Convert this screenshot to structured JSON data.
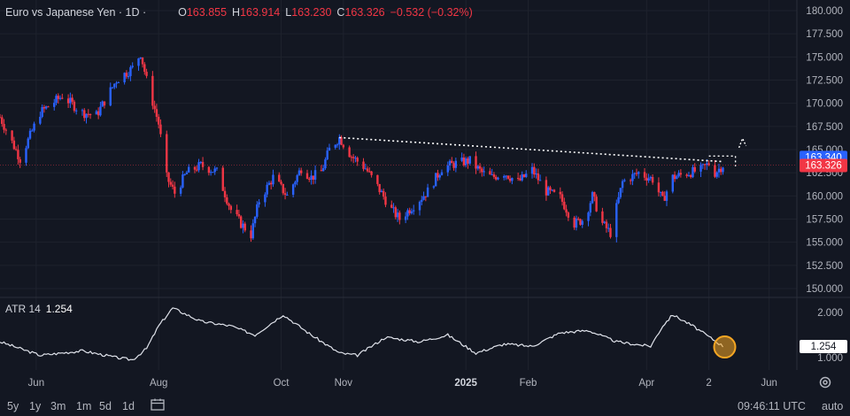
{
  "header": {
    "title": "Euro vs Japanese Yen · 1D ·",
    "o_label": "O",
    "o_value": "163.855",
    "h_label": "H",
    "h_value": "163.914",
    "l_label": "L",
    "l_value": "163.230",
    "c_label": "C",
    "c_value": "163.326",
    "change": "−0.532 (−0.32%)"
  },
  "atr": {
    "label": "ATR 14",
    "value": "1.254",
    "axis_ticks": [
      "2.000",
      "1.000"
    ],
    "badge": "1.254"
  },
  "price_badges": {
    "upper": "163.340",
    "lower": "163.326"
  },
  "timeframes": [
    "5y",
    "1y",
    "3m",
    "1m",
    "5d",
    "1d"
  ],
  "time": "09:46:11 UTC",
  "auto": "auto",
  "colors": {
    "up": "#2962ff",
    "down": "#f23645",
    "bg": "#131722",
    "grid": "#1e222d",
    "atr": "#e0e3eb",
    "highlight": "#f5a623"
  },
  "chart_data": {
    "type": "candlestick",
    "title": "Euro vs Japanese Yen · 1D",
    "y_ticks": [
      180,
      177.5,
      175,
      172.5,
      170,
      167.5,
      165,
      162.5,
      160,
      157.5,
      155,
      152.5,
      150
    ],
    "x_ticks": [
      "Jun",
      "Aug",
      "Oct",
      "Nov",
      "2025",
      "Feb",
      "Apr",
      "2",
      "Jun"
    ],
    "close_path": [
      [
        "2024-05-14",
        168.5
      ],
      [
        "2024-05-24",
        164.0
      ],
      [
        "2024-06-03",
        169.0
      ],
      [
        "2024-06-14",
        170.8
      ],
      [
        "2024-06-24",
        169.0
      ],
      [
        "2024-07-01",
        168.7
      ],
      [
        "2024-07-11",
        172.5
      ],
      [
        "2024-07-19",
        173.8
      ],
      [
        "2024-07-23",
        175.4
      ],
      [
        "2024-07-26",
        172.5
      ],
      [
        "2024-08-01",
        167.8
      ],
      [
        "2024-08-05",
        162.0
      ],
      [
        "2024-08-09",
        160.3
      ],
      [
        "2024-08-15",
        162.5
      ],
      [
        "2024-08-22",
        163.3
      ],
      [
        "2024-08-30",
        162.6
      ],
      [
        "2024-09-06",
        158.5
      ],
      [
        "2024-09-11",
        157.0
      ],
      [
        "2024-09-16",
        155.8
      ],
      [
        "2024-09-20",
        159.5
      ],
      [
        "2024-09-27",
        162.0
      ],
      [
        "2024-10-04",
        160.0
      ],
      [
        "2024-10-11",
        163.0
      ],
      [
        "2024-10-16",
        162.0
      ],
      [
        "2024-10-21",
        162.6
      ],
      [
        "2024-10-25",
        165.0
      ],
      [
        "2024-10-30",
        166.3
      ],
      [
        "2024-11-05",
        164.3
      ],
      [
        "2024-11-12",
        163.0
      ],
      [
        "2024-11-18",
        161.0
      ],
      [
        "2024-11-25",
        158.5
      ],
      [
        "2024-11-29",
        157.5
      ],
      [
        "2024-12-06",
        159.0
      ],
      [
        "2024-12-13",
        160.5
      ],
      [
        "2024-12-20",
        163.0
      ],
      [
        "2024-12-27",
        163.5
      ],
      [
        "2025-01-03",
        163.8
      ],
      [
        "2025-01-09",
        162.5
      ],
      [
        "2025-01-14",
        162.0
      ],
      [
        "2025-01-20",
        162.5
      ],
      [
        "2025-01-27",
        161.5
      ],
      [
        "2025-02-03",
        162.8
      ],
      [
        "2025-02-10",
        160.5
      ],
      [
        "2025-02-17",
        159.8
      ],
      [
        "2025-02-24",
        157.0
      ],
      [
        "2025-03-01",
        157.5
      ],
      [
        "2025-03-05",
        160.0
      ],
      [
        "2025-03-10",
        157.0
      ],
      [
        "2025-03-14",
        156.0
      ],
      [
        "2025-03-20",
        161.5
      ],
      [
        "2025-03-28",
        162.5
      ],
      [
        "2025-04-04",
        161.8
      ],
      [
        "2025-04-09",
        159.5
      ],
      [
        "2025-04-14",
        162.0
      ],
      [
        "2025-04-22",
        162.5
      ],
      [
        "2025-04-28",
        162.8
      ],
      [
        "2025-05-02",
        163.5
      ],
      [
        "2025-05-05",
        162.5
      ],
      [
        "2025-05-09",
        163.326
      ]
    ],
    "trendline": {
      "from": [
        "2024-10-30",
        166.3
      ],
      "to": [
        "2025-05-09",
        163.7
      ],
      "style": "dotted"
    },
    "atr_path": [
      [
        "2024-05-14",
        1.35
      ],
      [
        "2024-06-03",
        1.05
      ],
      [
        "2024-06-24",
        1.15
      ],
      [
        "2024-07-11",
        1.0
      ],
      [
        "2024-07-19",
        0.95
      ],
      [
        "2024-07-26",
        1.2
      ],
      [
        "2024-08-01",
        1.7
      ],
      [
        "2024-08-08",
        2.1
      ],
      [
        "2024-08-22",
        1.8
      ],
      [
        "2024-09-06",
        1.7
      ],
      [
        "2024-09-18",
        1.5
      ],
      [
        "2024-10-02",
        1.95
      ],
      [
        "2024-10-16",
        1.5
      ],
      [
        "2024-10-30",
        1.1
      ],
      [
        "2024-11-08",
        1.05
      ],
      [
        "2024-11-22",
        1.45
      ],
      [
        "2024-12-09",
        1.35
      ],
      [
        "2024-12-23",
        1.5
      ],
      [
        "2025-01-06",
        1.1
      ],
      [
        "2025-01-20",
        1.3
      ],
      [
        "2025-02-03",
        1.25
      ],
      [
        "2025-02-17",
        1.55
      ],
      [
        "2025-03-03",
        1.6
      ],
      [
        "2025-03-17",
        1.35
      ],
      [
        "2025-04-03",
        1.25
      ],
      [
        "2025-04-09",
        1.7
      ],
      [
        "2025-04-14",
        1.95
      ],
      [
        "2025-04-24",
        1.7
      ],
      [
        "2025-05-09",
        1.254
      ]
    ]
  }
}
